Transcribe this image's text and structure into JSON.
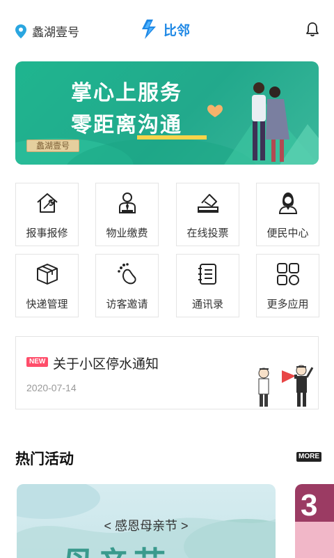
{
  "header": {
    "location": "蠡湖壹号",
    "brand_name": "比邻",
    "location_icon": "location-pin-icon",
    "brand_icon": "lightning-logo-icon",
    "notification_icon": "bell-icon",
    "brand_color": "#1e88e5"
  },
  "banner": {
    "line1": "掌心上服务",
    "line2": "零距离沟通",
    "sign_text": "蠡湖壹号"
  },
  "services": [
    {
      "label": "报事报修",
      "icon": "house-wrench-icon"
    },
    {
      "label": "物业缴费",
      "icon": "staff-person-icon"
    },
    {
      "label": "在线投票",
      "icon": "ballot-box-icon"
    },
    {
      "label": "便民中心",
      "icon": "service-agent-icon"
    },
    {
      "label": "快递管理",
      "icon": "package-box-icon"
    },
    {
      "label": "访客邀请",
      "icon": "visitor-footprint-icon"
    },
    {
      "label": "通讯录",
      "icon": "address-book-icon"
    },
    {
      "label": "更多应用",
      "icon": "apps-grid-icon"
    }
  ],
  "notice": {
    "badge": "NEW",
    "title": "关于小区停水通知",
    "date": "2020-07-14"
  },
  "hot": {
    "title": "热门活动",
    "more": "MORE",
    "cards": [
      {
        "title": "< 感恩母亲节 >",
        "big_text": "母亲节"
      },
      {
        "big_text": "3"
      }
    ]
  }
}
